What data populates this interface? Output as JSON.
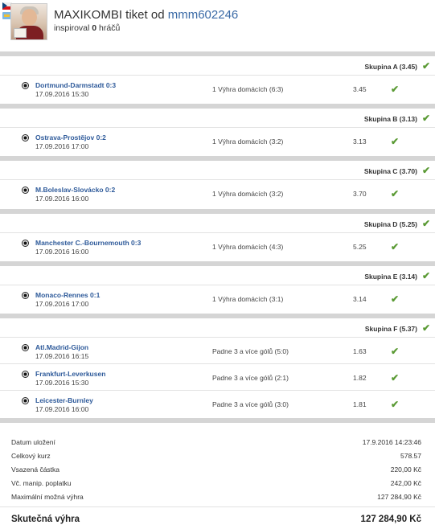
{
  "header": {
    "title_prefix": "MAXIKOMBI tiket od ",
    "owner": "mmm602246",
    "inspired_prefix": "inspiroval ",
    "inspired_count": "0",
    "inspired_suffix": " hráčů"
  },
  "groups": [
    {
      "title": "Skupina A (3.45)",
      "bets": [
        {
          "match": "Dortmund-Darmstadt 0:3",
          "datetime": "17.09.2016 15:30",
          "pick": "1 Výhra domácích (6:3)",
          "odds": "3.45"
        }
      ]
    },
    {
      "title": "Skupina B (3.13)",
      "bets": [
        {
          "match": "Ostrava-Prostějov 0:2",
          "datetime": "17.09.2016 17:00",
          "pick": "1 Výhra domácích (3:2)",
          "odds": "3.13"
        }
      ]
    },
    {
      "title": "Skupina C (3.70)",
      "bets": [
        {
          "match": "M.Boleslav-Slovácko 0:2",
          "datetime": "17.09.2016 16:00",
          "pick": "1 Výhra domácích (3:2)",
          "odds": "3.70"
        }
      ]
    },
    {
      "title": "Skupina D (5.25)",
      "bets": [
        {
          "match": "Manchester C.-Bournemouth 0:3",
          "datetime": "17.09.2016 16:00",
          "pick": "1 Výhra domácích (4:3)",
          "odds": "5.25"
        }
      ]
    },
    {
      "title": "Skupina E (3.14)",
      "bets": [
        {
          "match": "Monaco-Rennes 0:1",
          "datetime": "17.09.2016 17:00",
          "pick": "1 Výhra domácích (3:1)",
          "odds": "3.14"
        }
      ]
    },
    {
      "title": "Skupina F (5.37)",
      "bets": [
        {
          "match": "Atl.Madrid-Gijon",
          "datetime": "17.09.2016 16:15",
          "pick": "Padne 3 a více gólů (5:0)",
          "odds": "1.63"
        },
        {
          "match": "Frankfurt-Leverkusen",
          "datetime": "17.09.2016 15:30",
          "pick": "Padne 3 a více gólů (2:1)",
          "odds": "1.82"
        },
        {
          "match": "Leicester-Burnley",
          "datetime": "17.09.2016 16:00",
          "pick": "Padne 3 a více gólů (3:0)",
          "odds": "1.81"
        }
      ]
    }
  ],
  "summary": {
    "rows": [
      {
        "label": "Datum uložení",
        "value": "17.9.2016 14:23:46"
      },
      {
        "label": "Celkový kurz",
        "value": "578.57"
      },
      {
        "label": "Vsazená částka",
        "value": "220,00 Kč"
      },
      {
        "label": "Vč. manip. poplatku",
        "value": "242,00 Kč"
      },
      {
        "label": "Maximální možná výhra",
        "value": "127 284,90 Kč"
      }
    ],
    "total_label": "Skutečná výhra",
    "total_value": "127 284,90 Kč"
  },
  "icons": {
    "check": "check-icon",
    "ball": "soccer-ball-icon",
    "flag": "czech-flag-icon"
  },
  "colors": {
    "link": "#2e5a9a",
    "success": "#5a9a34",
    "separator": "#d5d5d5"
  }
}
